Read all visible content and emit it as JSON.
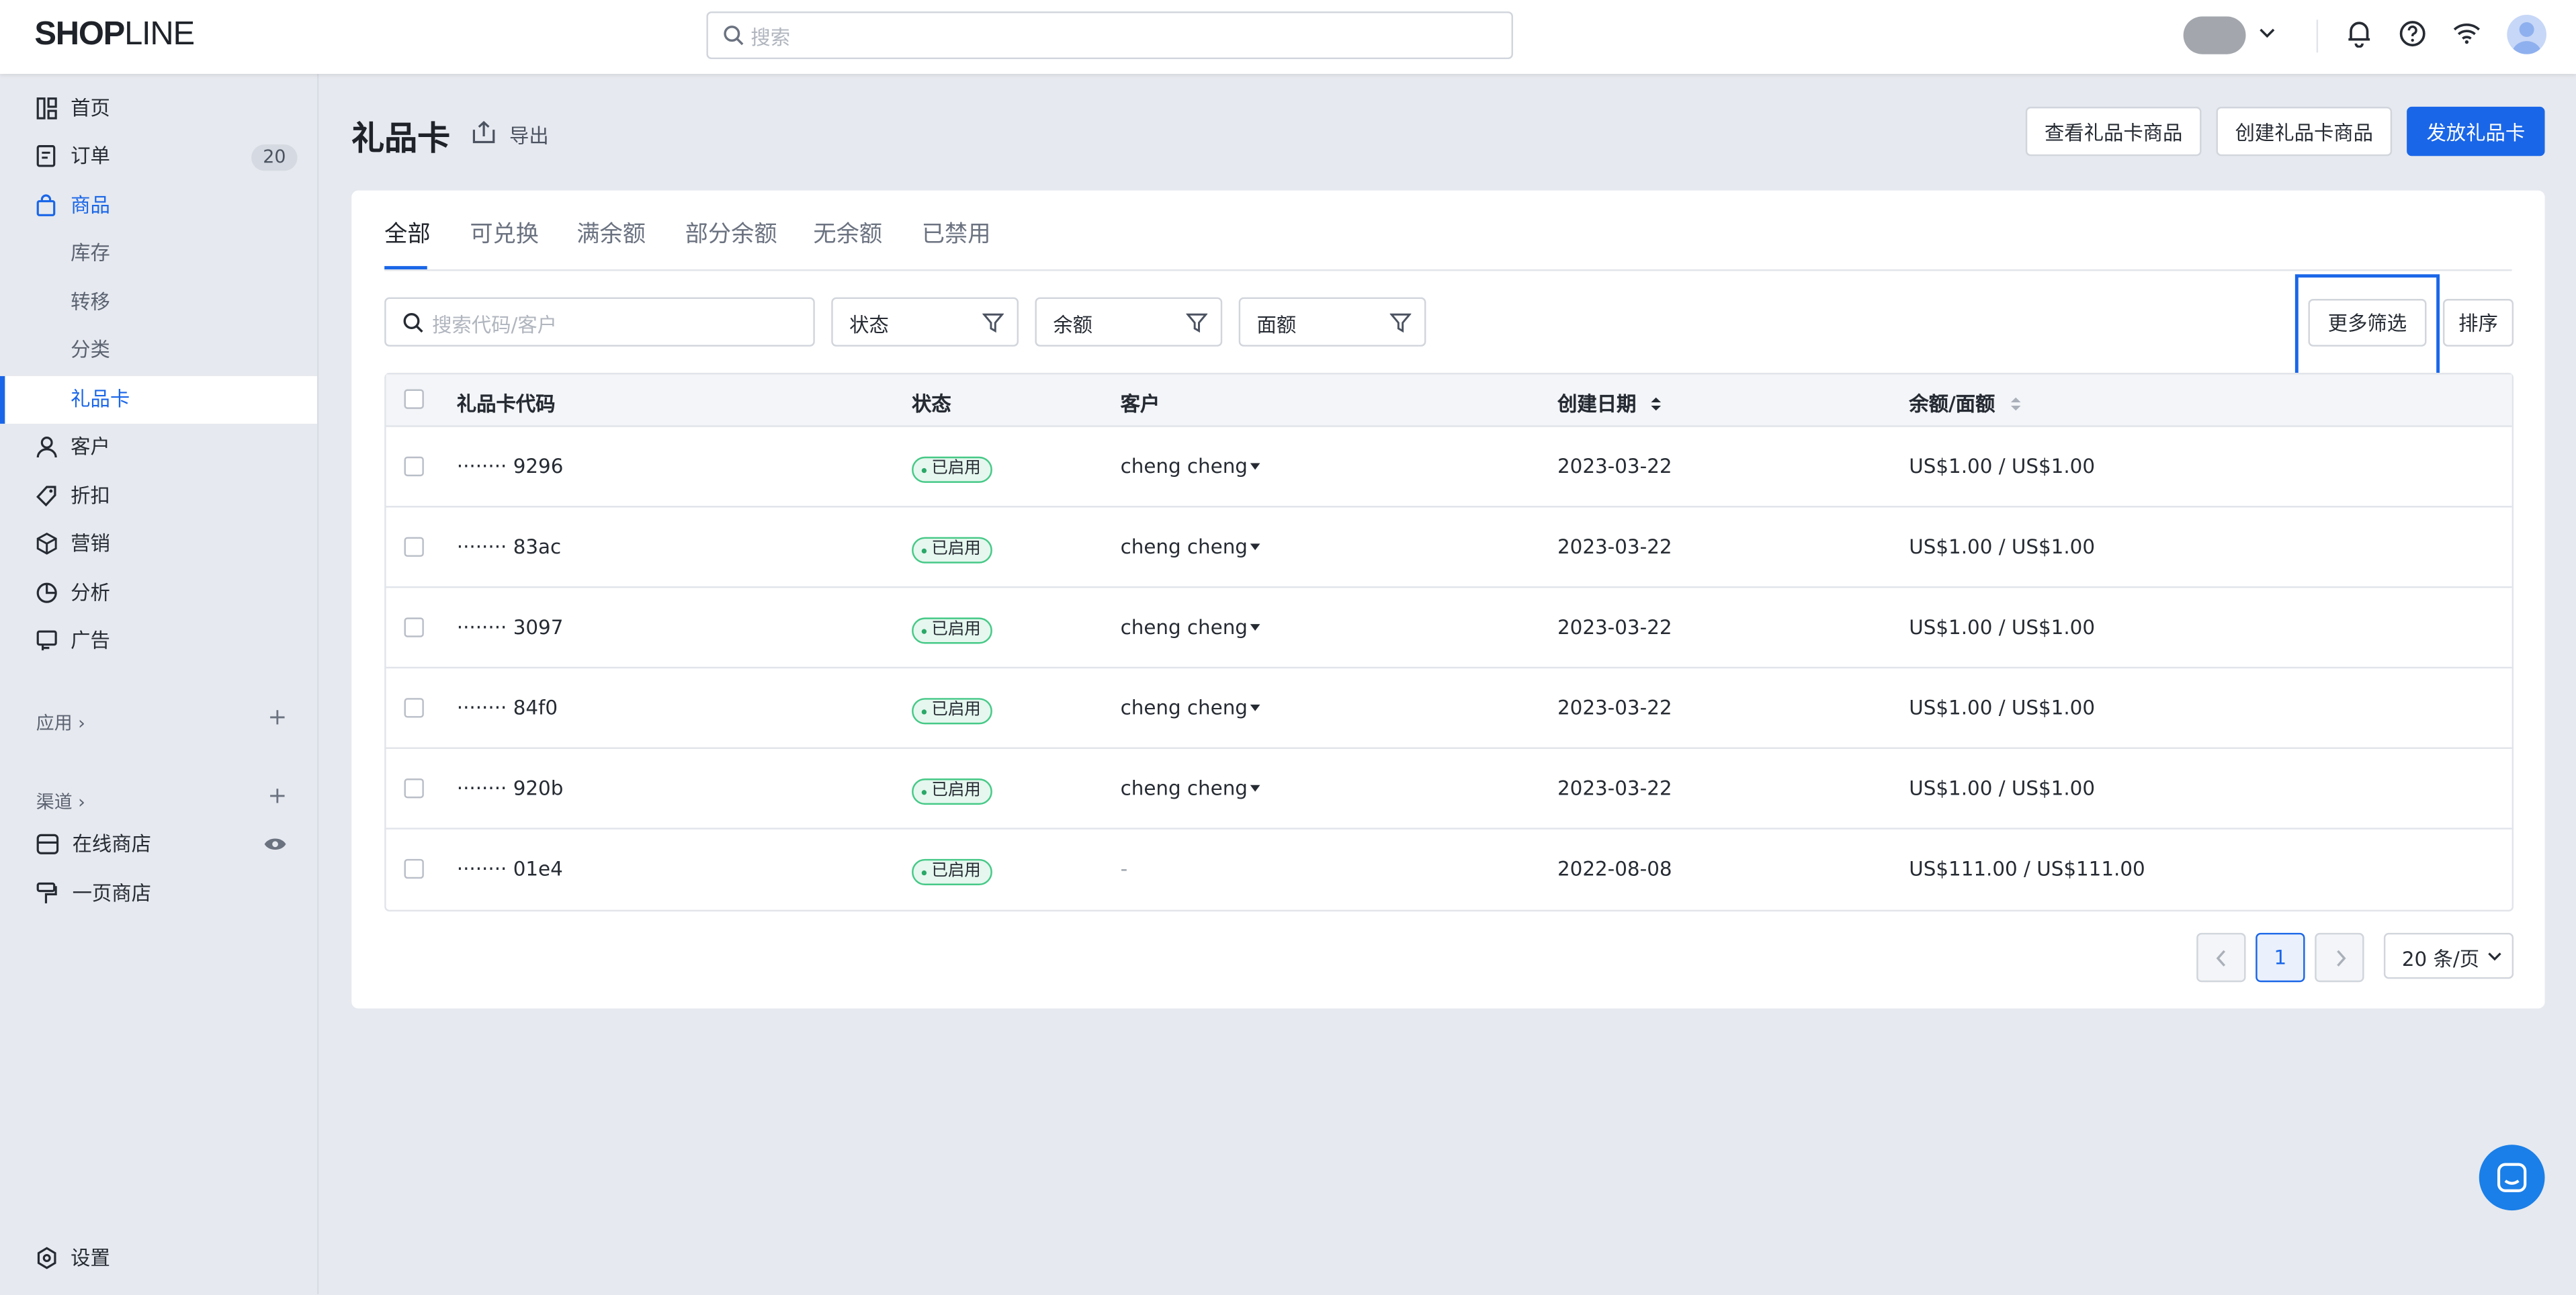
{
  "brand": {
    "logo_bold": "SHOP",
    "logo_regular": "LINE"
  },
  "header": {
    "search_placeholder": "搜索"
  },
  "sidebar": {
    "items": [
      {
        "label": "首页",
        "icon": "dashboard-icon"
      },
      {
        "label": "订单",
        "icon": "order-icon",
        "badge": "20"
      },
      {
        "label": "商品",
        "icon": "bag-icon"
      },
      {
        "label": "库存"
      },
      {
        "label": "转移"
      },
      {
        "label": "分类"
      },
      {
        "label": "礼品卡"
      },
      {
        "label": "客户",
        "icon": "user-icon"
      },
      {
        "label": "折扣",
        "icon": "tag-icon"
      },
      {
        "label": "营销",
        "icon": "cube-icon"
      },
      {
        "label": "分析",
        "icon": "pie-icon"
      },
      {
        "label": "广告",
        "icon": "ad-icon"
      }
    ],
    "apps_title": "应用",
    "channels_title": "渠道",
    "channels": [
      {
        "label": "在线商店",
        "icon": "store-icon"
      },
      {
        "label": "一页商店",
        "icon": "roller-icon"
      }
    ],
    "settings_label": "设置"
  },
  "page": {
    "title": "礼品卡",
    "export_label": "导出",
    "actions": {
      "view_products": "查看礼品卡商品",
      "create_product": "创建礼品卡商品",
      "issue": "发放礼品卡"
    }
  },
  "tabs": [
    "全部",
    "可兑换",
    "满余额",
    "部分余额",
    "无余额",
    "已禁用"
  ],
  "filters": {
    "search_placeholder": "搜索代码/客户",
    "status": "状态",
    "balance": "余额",
    "denomination": "面额",
    "more": "更多筛选",
    "sort": "排序"
  },
  "table": {
    "columns": [
      "礼品卡代码",
      "状态",
      "客户",
      "创建日期",
      "余额/面额"
    ],
    "rows": [
      {
        "code": "········ 9296",
        "status": "已启用",
        "customer": "cheng cheng",
        "date": "2023-03-22",
        "balance": "US$1.00 / US$1.00"
      },
      {
        "code": "········ 83ac",
        "status": "已启用",
        "customer": "cheng cheng",
        "date": "2023-03-22",
        "balance": "US$1.00 / US$1.00"
      },
      {
        "code": "········ 3097",
        "status": "已启用",
        "customer": "cheng cheng",
        "date": "2023-03-22",
        "balance": "US$1.00 / US$1.00"
      },
      {
        "code": "········ 84f0",
        "status": "已启用",
        "customer": "cheng cheng",
        "date": "2023-03-22",
        "balance": "US$1.00 / US$1.00"
      },
      {
        "code": "········ 920b",
        "status": "已启用",
        "customer": "cheng cheng",
        "date": "2023-03-22",
        "balance": "US$1.00 / US$1.00"
      },
      {
        "code": "········ 01e4",
        "status": "已启用",
        "customer": "-",
        "date": "2022-08-08",
        "balance": "US$111.00 / US$111.00"
      }
    ]
  },
  "pagination": {
    "current": "1",
    "page_size": "20 条/页"
  },
  "colors": {
    "primary": "#1a66e8",
    "success": "#2aa868"
  }
}
